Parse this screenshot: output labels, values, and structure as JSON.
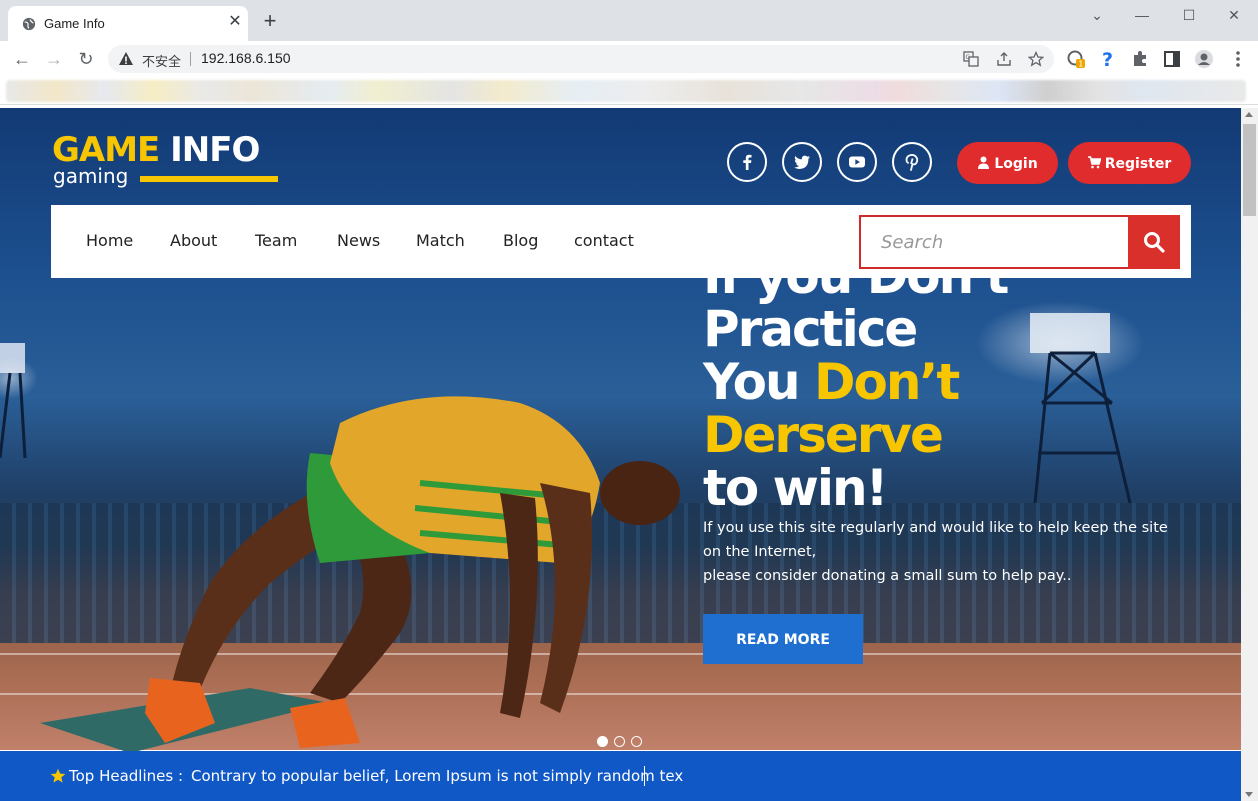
{
  "browser": {
    "tab_title": "Game Info",
    "new_tab": "+",
    "insecure_label": "不安全",
    "url": "192.168.6.150",
    "extension_badge": "1"
  },
  "site": {
    "logo": {
      "word1": "GAME",
      "word2": "INFO",
      "sub": "gaming"
    },
    "social": [
      "facebook-icon",
      "twitter-icon",
      "youtube-icon",
      "pinterest-icon"
    ],
    "login_label": "Login",
    "register_label": "Register",
    "nav": [
      "Home",
      "About",
      "Team",
      "News",
      "Match",
      "Blog",
      "contact"
    ],
    "search_placeholder": "Search",
    "headline": {
      "line1": "If you Don't",
      "line2": "Practice",
      "line3a": "You ",
      "line3b": "Don’t",
      "line4": "Derserve",
      "line5": "to win!"
    },
    "hero_text_1": "If you use this site regularly and would like to help keep the site on the Internet,",
    "hero_text_2": "please consider donating a small sum to help pay..",
    "read_more_label": "READ MORE",
    "slider": {
      "total": 3,
      "active": 1
    },
    "ticker": {
      "label": "Top Headlines :",
      "text": "Contrary to popular belief, Lorem Ipsum is not simply random tex"
    }
  },
  "colors": {
    "accent_yellow": "#f7c600",
    "button_red": "#e02c2c",
    "read_more_blue": "#1f6fd1",
    "ticker_blue": "#1158c7"
  }
}
